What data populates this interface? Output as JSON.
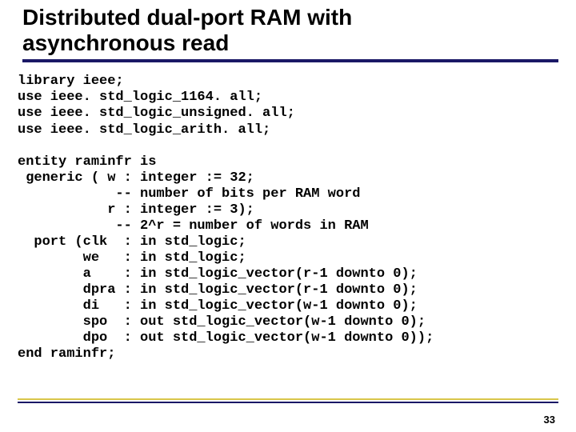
{
  "title_line1": "Distributed dual-port RAM with",
  "title_line2": "asynchronous read",
  "code": "library ieee;\nuse ieee. std_logic_1164. all;\nuse ieee. std_logic_unsigned. all;\nuse ieee. std_logic_arith. all;\n\nentity raminfr is\n generic ( w : integer := 32;\n            -- number of bits per RAM word\n           r : integer := 3);\n            -- 2^r = number of words in RAM\n  port (clk  : in std_logic;\n        we   : in std_logic;\n        a    : in std_logic_vector(r-1 downto 0);\n        dpra : in std_logic_vector(r-1 downto 0);\n        di   : in std_logic_vector(w-1 downto 0);\n        spo  : out std_logic_vector(w-1 downto 0);\n        dpo  : out std_logic_vector(w-1 downto 0));\nend raminfr;",
  "page_number": "33"
}
